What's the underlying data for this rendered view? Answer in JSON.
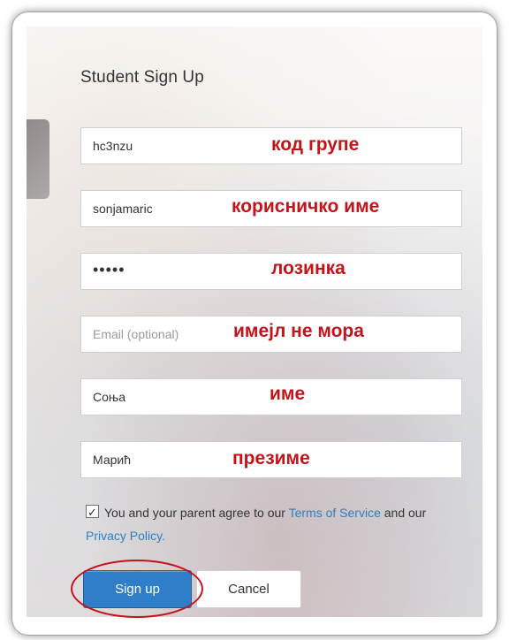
{
  "form": {
    "title": "Student Sign Up",
    "fields": [
      {
        "value": "hc3nzu",
        "note": "код групе"
      },
      {
        "value": "sonjamaric",
        "note": "корисничко име"
      },
      {
        "value": "•••••",
        "note": "лозинка"
      },
      {
        "placeholder": "Email (optional)",
        "note": "имејл не мора"
      },
      {
        "value": "Соња",
        "note": "име"
      },
      {
        "value": "Марић",
        "note": "презиме"
      }
    ],
    "agree": {
      "checked": true,
      "text_before": "You and your parent agree to our",
      "terms_link": "Terms of Service",
      "text_middle": "and our",
      "privacy_link": "Privacy Policy."
    },
    "buttons": {
      "signup": "Sign up",
      "cancel": "Cancel"
    }
  },
  "colors": {
    "accent": "#2f7ec9",
    "annotation": "#c4141a",
    "link": "#2e7fc2"
  }
}
